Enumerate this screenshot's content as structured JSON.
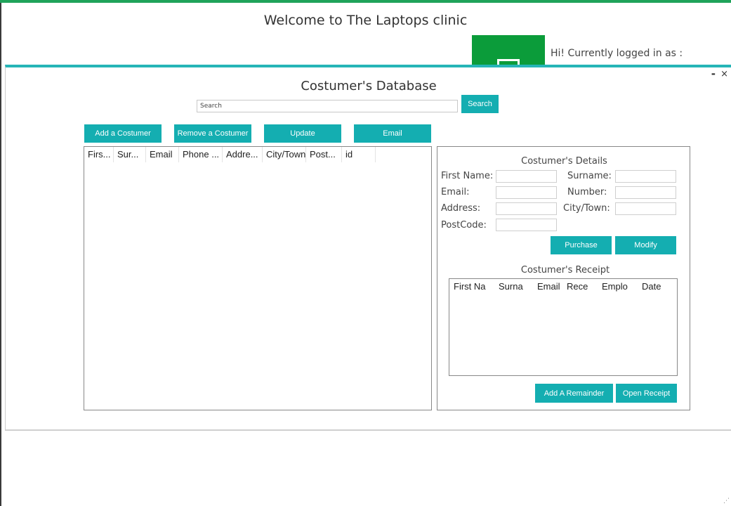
{
  "main_window": {
    "welcome": "Welcome to The Laptops clinic",
    "logged_in_text": "Hi! Currently logged in as :",
    "resize_grip": "⋰"
  },
  "dialog": {
    "title": "Costumer's Database",
    "minimize": "-",
    "close": "×",
    "search": {
      "placeholder": "Search",
      "button": "Search"
    },
    "actions": {
      "add": "Add a Costumer",
      "remove": "Remove a Costumer",
      "update": "Update",
      "email": "Email"
    },
    "customer_list": {
      "columns": [
        "Firs...",
        "Sur...",
        "Email",
        "Phone ...",
        "Addre...",
        "City/Town",
        "Post...",
        "id"
      ]
    },
    "details": {
      "title": "Costumer's Details",
      "labels": {
        "first_name": "First Name:",
        "surname": "Surname:",
        "email": "Email:",
        "number": "Number:",
        "address": "Address:",
        "city": "City/Town:",
        "postcode": "PostCode:"
      },
      "purchase": "Purchase",
      "modify": "Modify",
      "receipt_title": "Costumer's Receipt",
      "receipt_columns": [
        "First Na",
        "Surna",
        "Email",
        "Rece",
        "Emplo",
        "Date"
      ],
      "add_reminder": "Add A Remainder",
      "open_receipt": "Open Receipt"
    }
  },
  "colors": {
    "accent": "#14aeb1",
    "green_tile": "#0b9c3a",
    "top_strip": "#1fa35a"
  }
}
